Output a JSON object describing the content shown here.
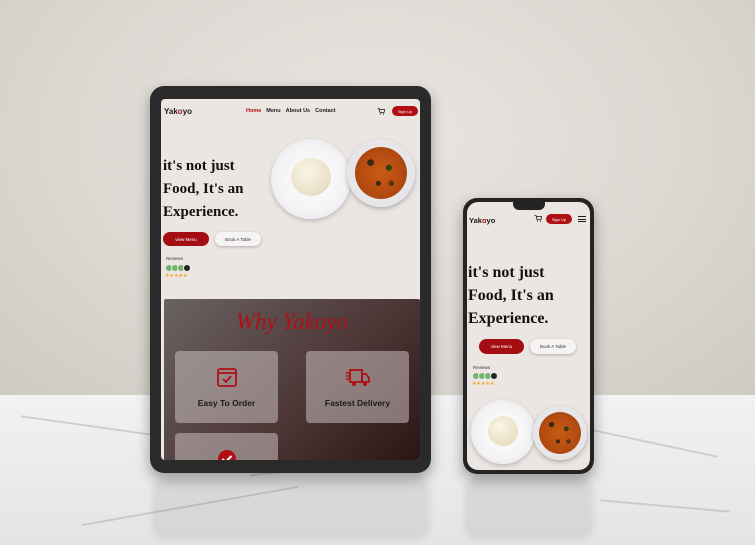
{
  "brand": {
    "logo_prefix": "Yak",
    "logo_accent": "o",
    "logo_suffix": "yo",
    "accent_color": "#b00f14"
  },
  "nav": {
    "links": [
      {
        "label": "Home",
        "active": true
      },
      {
        "label": "Menu",
        "active": false
      },
      {
        "label": "About Us",
        "active": false
      },
      {
        "label": "Contact",
        "active": false
      }
    ],
    "cart_icon": "cart-icon",
    "signup_label": "Sign Up",
    "menu_icon": "hamburger-menu-icon"
  },
  "hero": {
    "title_lines": [
      "it's not just",
      "Food, It's an",
      "Experience."
    ],
    "view_menu_label": "view Menu",
    "book_table_label": "Book A Table"
  },
  "reviews": {
    "label": "Reviews",
    "avatar_more": "2k+",
    "stars": "★★★★★",
    "rating": 5
  },
  "why": {
    "title": "Why Yakoyo",
    "features": [
      {
        "label": "Easy To Order",
        "icon": "checklist-icon"
      },
      {
        "label": "Fastest Delivery",
        "icon": "delivery-truck-icon"
      },
      {
        "label": "",
        "icon": "quality-badge-icon"
      }
    ]
  }
}
